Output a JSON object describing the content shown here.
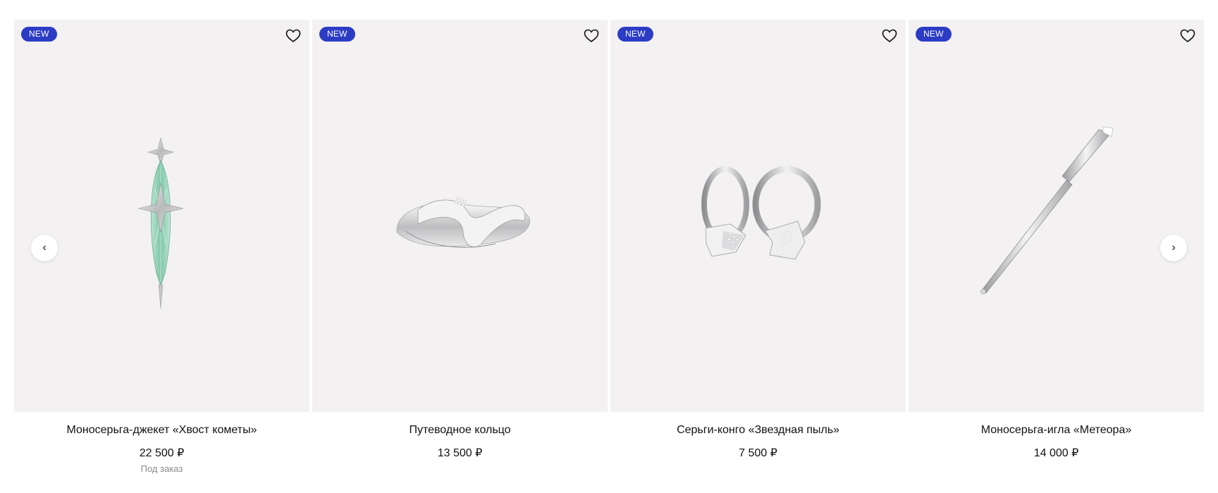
{
  "carousel": {
    "prev_icon": "chevron-left-icon",
    "next_icon": "chevron-right-icon",
    "prev_glyph": "‹",
    "next_glyph": "›",
    "products": [
      {
        "badge": "NEW",
        "title": "Моносерьга-джекет «Хвост кометы»",
        "price": "22 500 ₽",
        "note": "Под заказ",
        "favorite_icon": "heart-icon"
      },
      {
        "badge": "NEW",
        "title": "Путеводное кольцо",
        "price": "13 500 ₽",
        "favorite_icon": "heart-icon"
      },
      {
        "badge": "NEW",
        "title": "Серьги-конго «Звездная пыль»",
        "price": "7 500 ₽",
        "favorite_icon": "heart-icon"
      },
      {
        "badge": "NEW",
        "title": "Моносерьга-игла «Метеора»",
        "price": "14 000 ₽",
        "favorite_icon": "heart-icon"
      }
    ]
  },
  "colors": {
    "badge_bg": "#2c3cc5",
    "card_bg": "#f3f1f2",
    "note_text": "#8a8a8a"
  }
}
